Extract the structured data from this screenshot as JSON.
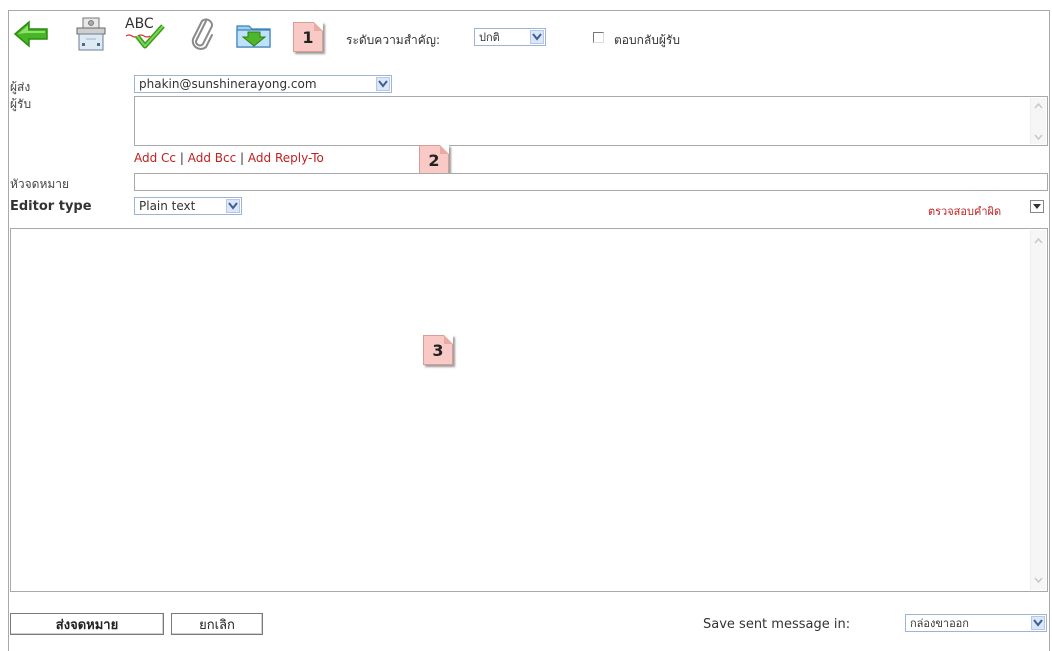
{
  "toolbar": {
    "back_icon": "back-arrow-icon",
    "fax_icon": "fax-icon",
    "spellcheck_icon_text": "ABC",
    "attach_icon": "paperclip-icon",
    "save_icon": "save-folder-icon",
    "priority_label": "ระดับความสำคัญ:",
    "priority_value": "ปกติ",
    "return_receipt_label": "ตอบกลับผู้รับ"
  },
  "callouts": [
    "1",
    "2",
    "3"
  ],
  "form": {
    "from_label": "ผู้ส่ง",
    "from_value": "phakin@sunshinerayong.com",
    "to_label": "ผู้รับ",
    "to_value": "",
    "add_cc": "Add Cc",
    "add_bcc": "Add Bcc",
    "add_reply_to": "Add Reply-To",
    "separator": "|",
    "subject_label": "หัวจดหมาย",
    "subject_value": "",
    "editor_type_label": "Editor type",
    "editor_type_value": "Plain text",
    "spellcheck_link": "ตรวจสอบคำผิด",
    "body_value": ""
  },
  "footer": {
    "send_button": "ส่งจดหมาย",
    "cancel_button": "ยกเลิก",
    "save_sent_label": "Save sent message in:",
    "save_sent_value": "กล่องขาออก"
  },
  "colors": {
    "link": "#c02020",
    "callout_bg": "#f9c9c6",
    "select_border": "#9cb4d8",
    "back_arrow": "#3fb21f"
  }
}
